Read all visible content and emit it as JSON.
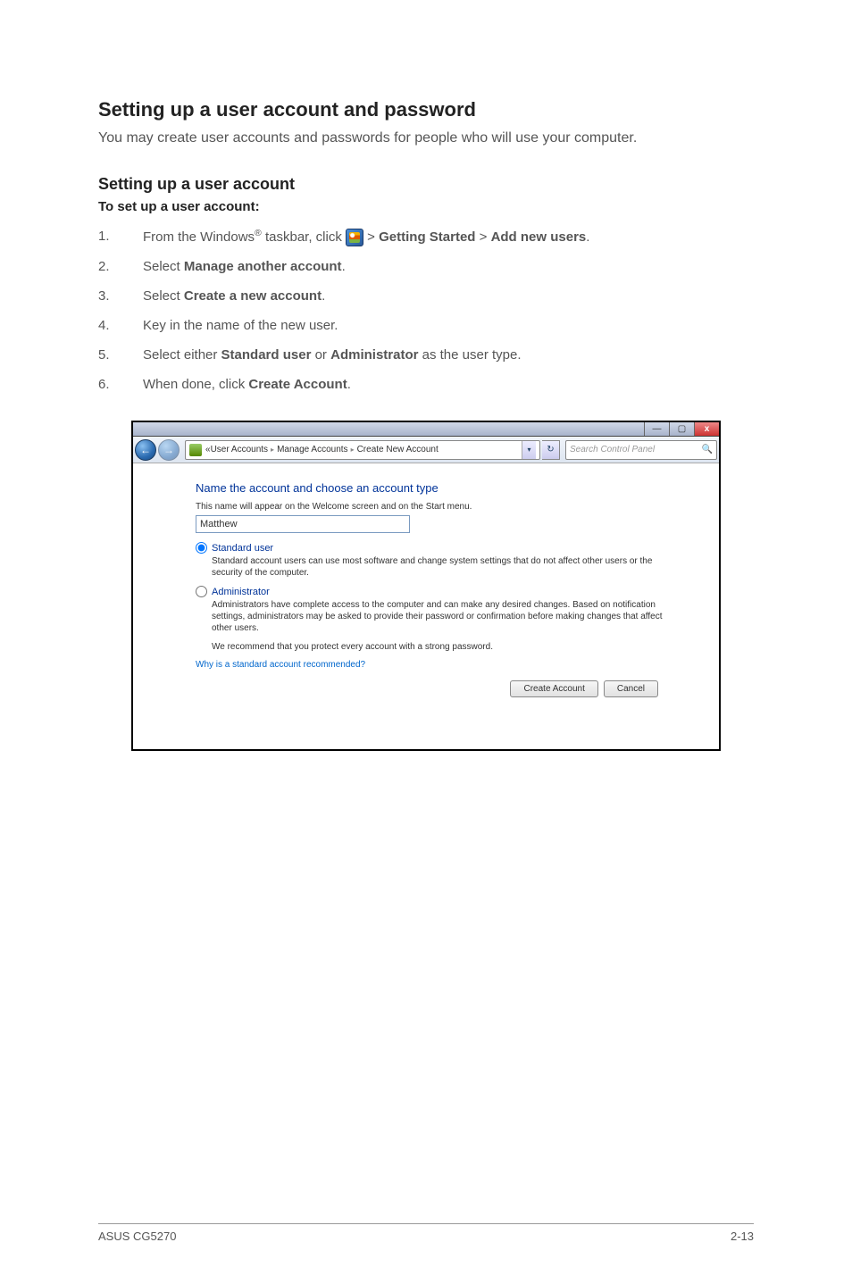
{
  "heading_main": "Setting up a user account and password",
  "intro_text": "You may create user accounts and passwords for people who will use your computer.",
  "heading_sub": "Setting up a user account",
  "bold_line": "To set up a user account:",
  "steps": {
    "s1_a": "From the Windows",
    "s1_b": " taskbar, click ",
    "s1_c": " > ",
    "s1_d": "Getting Started",
    "s1_e": " > ",
    "s1_f": "Add new users",
    "s1_g": ".",
    "s2_a": "Select ",
    "s2_b": "Manage another account",
    "s2_c": ".",
    "s3_a": "Select ",
    "s3_b": "Create a new account",
    "s3_c": ".",
    "s4": "Key in the name of the new user.",
    "s5_a": "Select either ",
    "s5_b": "Standard user",
    "s5_c": " or ",
    "s5_d": "Administrator",
    "s5_e": " as the user type.",
    "s6_a": "When done, click ",
    "s6_b": "Create Account",
    "s6_c": "."
  },
  "window": {
    "titlebar": {
      "min": "—",
      "max": "▢",
      "close": "x"
    },
    "nav": {
      "back": "←",
      "fwd": "→"
    },
    "breadcrumb": {
      "pre": "«",
      "c1": "User Accounts",
      "c2": "Manage Accounts",
      "c3": "Create New Account",
      "sep": "▸",
      "drop": "▾",
      "refresh": "↻"
    },
    "search": {
      "placeholder": "Search Control Panel",
      "icon": "🔍"
    },
    "content": {
      "heading": "Name the account and choose an account type",
      "sub": "This name will appear on the Welcome screen and on the Start menu.",
      "name_value": "Matthew",
      "std_label": "Standard user",
      "std_desc": "Standard account users can use most software and change system settings that do not affect other users or the security of the computer.",
      "adm_label": "Administrator",
      "adm_desc": "Administrators have complete access to the computer and can make any desired changes. Based on notification settings, administrators may be asked to provide their password or confirmation before making changes that affect other users.",
      "recommend": "We recommend that you protect every account with a strong password.",
      "link": "Why is a standard account recommended?",
      "btn_create": "Create Account",
      "btn_cancel": "Cancel"
    }
  },
  "footer": {
    "left": "ASUS CG5270",
    "right": "2-13"
  }
}
